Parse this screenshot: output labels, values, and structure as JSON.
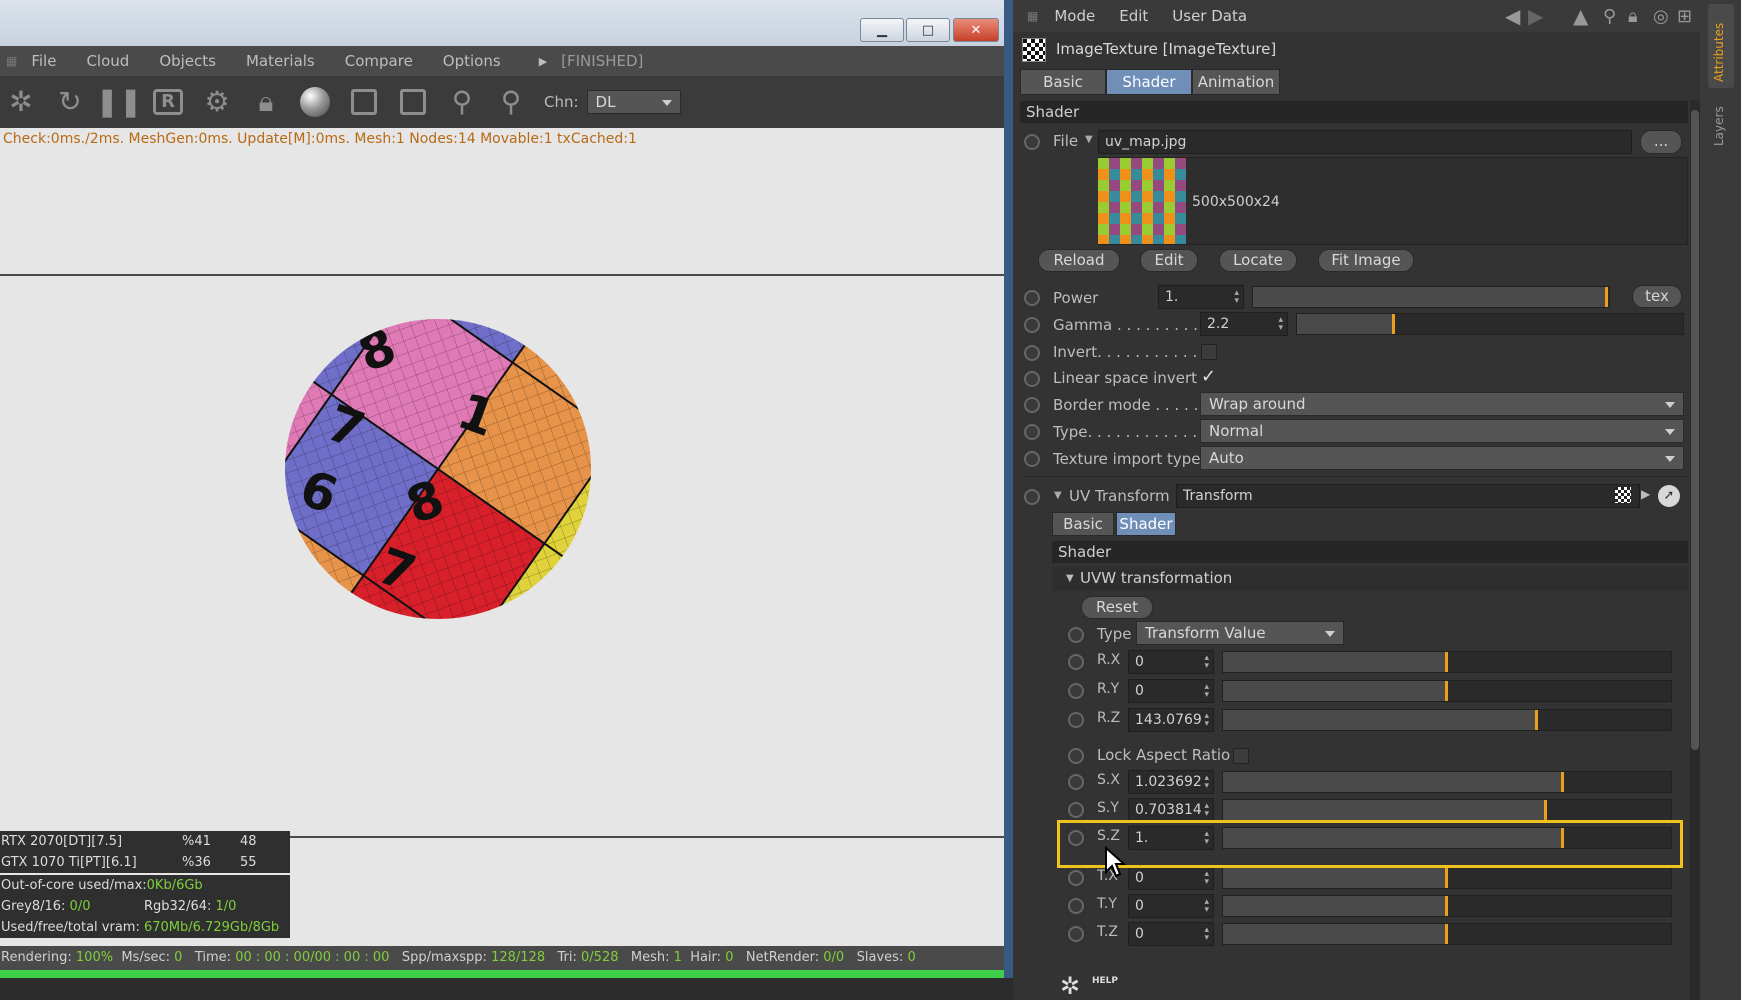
{
  "render_window": {
    "menu": [
      "File",
      "Cloud",
      "Objects",
      "Materials",
      "Compare",
      "Options"
    ],
    "status_tag": "[FINISHED]",
    "channel_label": "Chn:",
    "channel_value": "DL",
    "stats_line": "Check:0ms./2ms. MeshGen:0ms. Update[M]:0ms. Mesh:1 Nodes:14 Movable:1 txCached:1",
    "devices": [
      {
        "name": "RTX 2070[DT][7.5]",
        "pct": "%41",
        "temp": "48"
      },
      {
        "name": "GTX 1070 Ti[PT][6.1]",
        "pct": "%36",
        "temp": "55"
      }
    ],
    "memory": {
      "out_of_core_label": "Out-of-core used/max:",
      "out_of_core_value": "0Kb/6Gb",
      "grey_label": "Grey8/16:",
      "grey_value": "0/0",
      "rgb_label": "Rgb32/64:",
      "rgb_value": "1/0",
      "vram_label": "Used/free/total vram:",
      "vram_value": "670Mb/6.729Gb/8Gb"
    },
    "bottom_status": {
      "rendering_label": "Rendering:",
      "rendering_value": "100%",
      "ms_label": "Ms/sec:",
      "ms_value": "0",
      "time_label": "Time:",
      "time_value": "00 : 00 : 00/00 : 00 : 00",
      "spp_label": "Spp/maxspp:",
      "spp_value": "128/128",
      "tri_label": "Tri:",
      "tri_value": "0/528",
      "mesh_label": "Mesh:",
      "mesh_value": "1",
      "hair_label": "Hair:",
      "hair_value": "0",
      "net_label": "NetRender:",
      "net_value": "0/0",
      "slaves_label": "Slaves:",
      "slaves_value": "0"
    },
    "progress_fraction": 1.0,
    "render_digits": [
      "8",
      "7",
      "1",
      "6",
      "8",
      "7"
    ]
  },
  "attributes": {
    "menu": [
      "Mode",
      "Edit",
      "User Data"
    ],
    "object_title": "ImageTexture [ImageTexture]",
    "tabs": [
      "Basic",
      "Shader",
      "Animation"
    ],
    "active_tab": "Shader",
    "section_shader": "Shader",
    "file_label": "File",
    "file_value": "uv_map.jpg",
    "browse_label": "...",
    "image_info": "500x500x24",
    "image_buttons": [
      "Reload",
      "Edit",
      "Locate",
      "Fit Image"
    ],
    "power_label": "Power",
    "power_value": "1.",
    "power_fraction": 0.995,
    "tex_label": "tex",
    "gamma_label": "Gamma . . . . . . . . .",
    "gamma_value": "2.2",
    "gamma_fraction": 0.25,
    "invert_label": "Invert. . . . . . . . . . . . .",
    "linear_label": "Linear space invert",
    "linear_checked": "✓",
    "border_label": "Border mode . . . . .",
    "border_value": "Wrap around",
    "type_label": "Type. . . . . . . . . . . . .",
    "type_value": "Normal",
    "import_label": "Texture import type",
    "import_value": "Auto",
    "uv_label": "UV Transform",
    "uv_value": "Transform",
    "sub_tabs": [
      "Basic",
      "Shader"
    ],
    "sub_active": "Shader",
    "sub_section": "Shader",
    "uvw_label": "UVW transformation",
    "reset_label": "Reset",
    "uvw_type_label": "Type",
    "uvw_type_value": "Transform Value",
    "rows_a": [
      {
        "label": "R.X",
        "value": "0",
        "fraction": 0.5
      },
      {
        "label": "R.Y",
        "value": "0",
        "fraction": 0.5
      },
      {
        "label": "R.Z",
        "value": "143.0769",
        "fraction": 0.7
      }
    ],
    "lock_label": "Lock Aspect Ratio",
    "rows_b": [
      {
        "label": "S.X",
        "value": "1.023692",
        "fraction": 0.76
      },
      {
        "label": "S.Y",
        "value": "0.703814",
        "fraction": 0.72
      },
      {
        "label": "S.Z",
        "value": "1.",
        "fraction": 0.76
      }
    ],
    "rows_c": [
      {
        "label": "T.X",
        "value": "0",
        "fraction": 0.5
      },
      {
        "label": "T.Y",
        "value": "0",
        "fraction": 0.5
      },
      {
        "label": "T.Z",
        "value": "0",
        "fraction": 0.5
      }
    ],
    "help_label": "HELP",
    "highlight_color": "#f1c21b",
    "accent_color": "#e9a11c"
  },
  "side_tabs": [
    "Attributes",
    "Layers"
  ]
}
